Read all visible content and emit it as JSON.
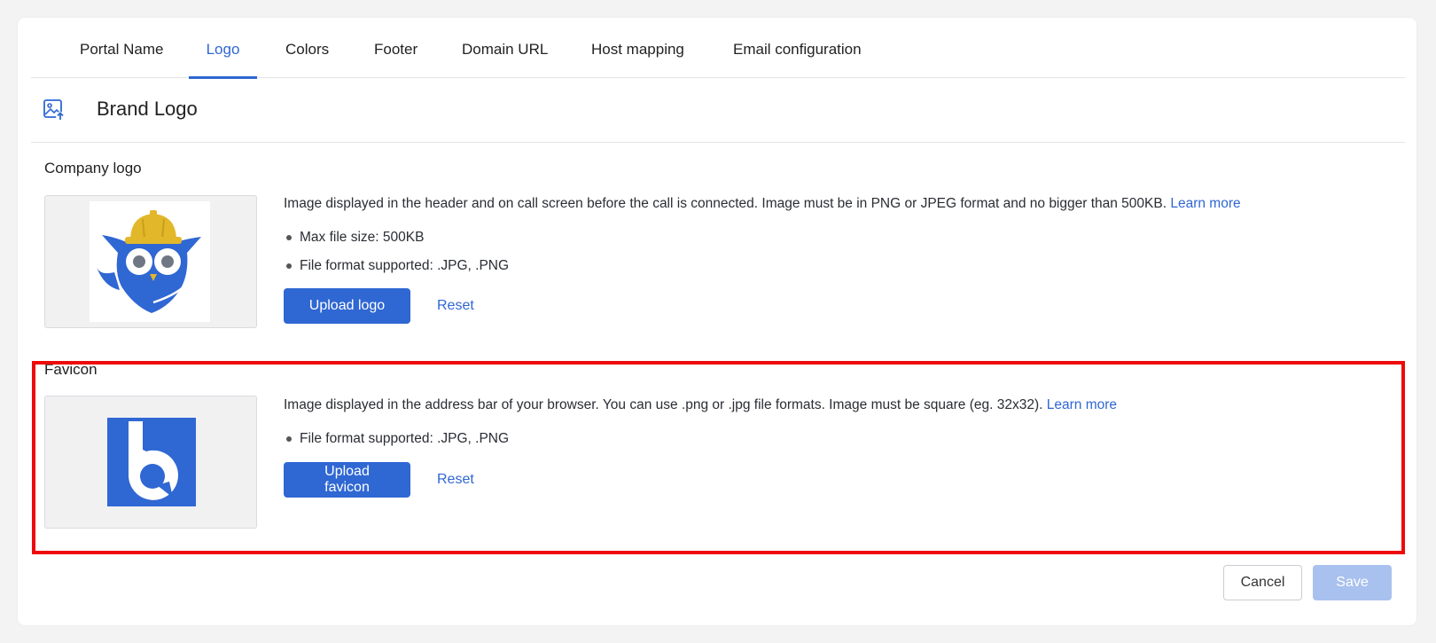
{
  "tabs": [
    {
      "label": "Portal Name"
    },
    {
      "label": "Logo",
      "active": true
    },
    {
      "label": "Colors"
    },
    {
      "label": "Footer"
    },
    {
      "label": "Domain URL"
    },
    {
      "label": "Host mapping"
    },
    {
      "label": "Email configuration"
    }
  ],
  "section": {
    "title": "Brand Logo",
    "icon": "image-upload-icon"
  },
  "company_logo": {
    "title": "Company logo",
    "description": "Image displayed in the header and on call screen before the call is connected. Image must be in PNG or JPEG format and no bigger than 500KB.",
    "learn_more": "Learn more",
    "bullets": [
      "Max file size: 500KB",
      "File format supported: .JPG, .PNG"
    ],
    "upload_label": "Upload logo",
    "reset_label": "Reset"
  },
  "favicon": {
    "title": "Favicon",
    "description": "Image displayed in the address bar of your browser. You can use .png or .jpg file formats. Image must be square (eg. 32x32).",
    "learn_more": "Learn more",
    "bullets": [
      "File format supported: .JPG, .PNG"
    ],
    "upload_label": "Upload favicon",
    "reset_label": "Reset"
  },
  "footer_actions": {
    "cancel_label": "Cancel",
    "save_label": "Save"
  },
  "colors": {
    "accent": "#2f67d3",
    "highlight": "#ee0a0a",
    "owl_yellow": "#e2b72a",
    "save_disabled": "#a9c1ee"
  }
}
